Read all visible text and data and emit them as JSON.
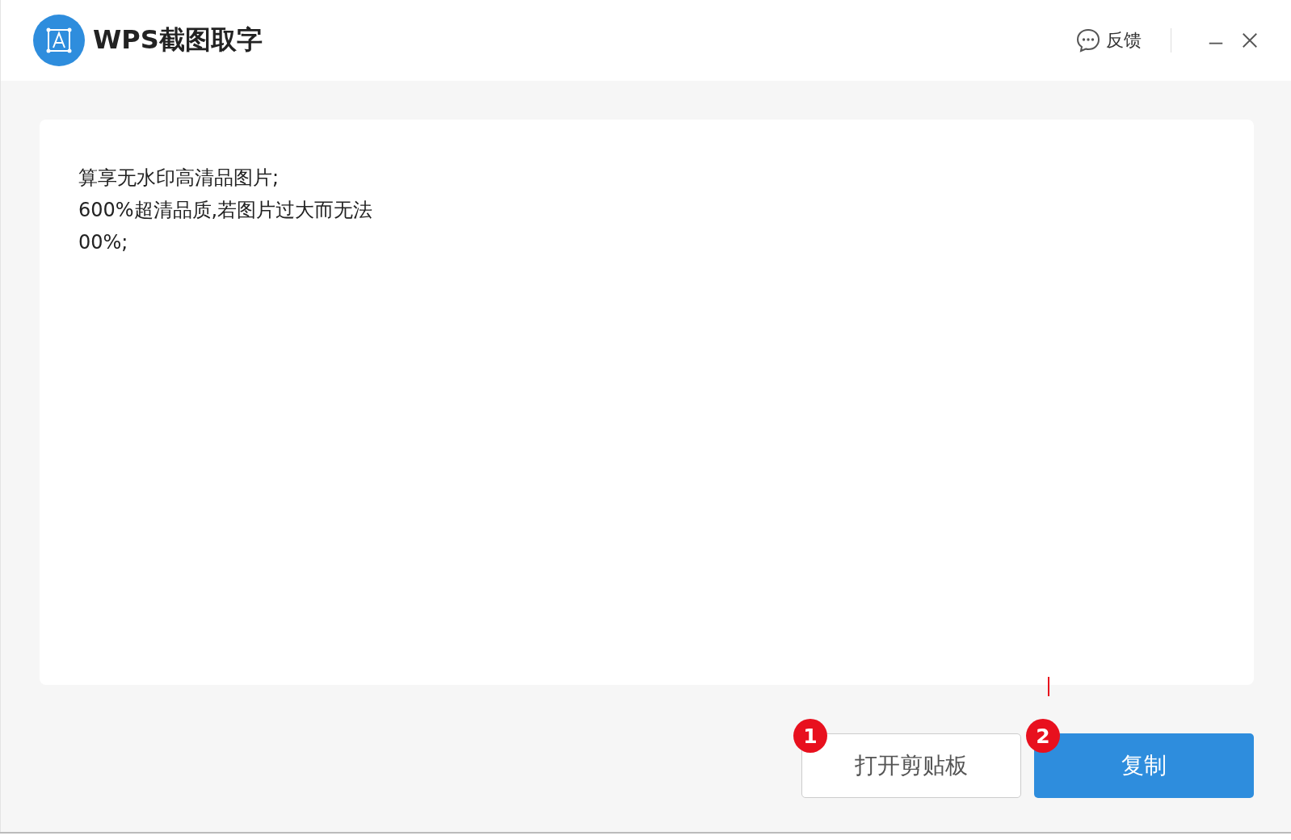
{
  "window": {
    "title": "WPS截图取字"
  },
  "header": {
    "feedback": "反馈"
  },
  "result_text": [
    "算享无水印高清品图片;",
    "600%超清品质,若图片过大而无法",
    "00%;"
  ],
  "buttons": [
    {
      "label": "打开剪贴板",
      "kind": "secondary",
      "badge": "1"
    },
    {
      "label": "复制",
      "kind": "primary",
      "badge": "2"
    }
  ]
}
